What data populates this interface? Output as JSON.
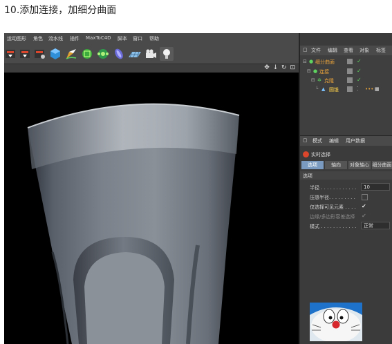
{
  "caption": "10.添加连接，加细分曲面",
  "menu": [
    "运动图形",
    "角色",
    "流水线",
    "插件",
    "MaxToC4D",
    "脚本",
    "窗口",
    "帮助"
  ],
  "viewport_nav": "✥ ↓ ↻ ⊡",
  "object_manager": {
    "menu": [
      "文件",
      "编辑",
      "查看",
      "对象",
      "标签"
    ],
    "rows": [
      {
        "label": "细分曲面",
        "selected": false
      },
      {
        "label": "连接",
        "selected": false
      },
      {
        "label": "克隆",
        "selected": false
      },
      {
        "label": "圆锥",
        "selected": true
      }
    ]
  },
  "attributes": {
    "menu": [
      "模式",
      "编辑",
      "用户数据"
    ],
    "tool_name": "实时选择",
    "tabs": [
      "选项",
      "轴向",
      "对象轴心",
      "细分曲面"
    ],
    "active_tab": 0,
    "section": "选项",
    "props": [
      {
        "name": "半径 . . . . . . . . . . . .",
        "type": "number",
        "value": "10",
        "enabled": true
      },
      {
        "name": "压感半径. . . . . . . . .",
        "type": "checkbox",
        "checked": false,
        "enabled": true
      },
      {
        "name": "仅选择可见元素 . . . .",
        "type": "checkbox",
        "checked": true,
        "enabled": true
      },
      {
        "name": "边缘/多边形容差选择",
        "type": "checkbox",
        "checked": true,
        "enabled": false
      },
      {
        "name": "模式 . . . . . . . . . . . .",
        "type": "select",
        "value": "正常",
        "enabled": true
      }
    ]
  },
  "icons": [
    "cube-icon",
    "pen-icon",
    "subdivision-icon",
    "cloner-icon",
    "deformer-icon",
    "floor-icon",
    "camera-icon",
    "light-icon"
  ],
  "colors": {
    "viewport_bg": "#000000",
    "panel_bg": "#3b3b3b",
    "object_label": "#e8a23a",
    "active_tab": "#7a9bbf"
  }
}
